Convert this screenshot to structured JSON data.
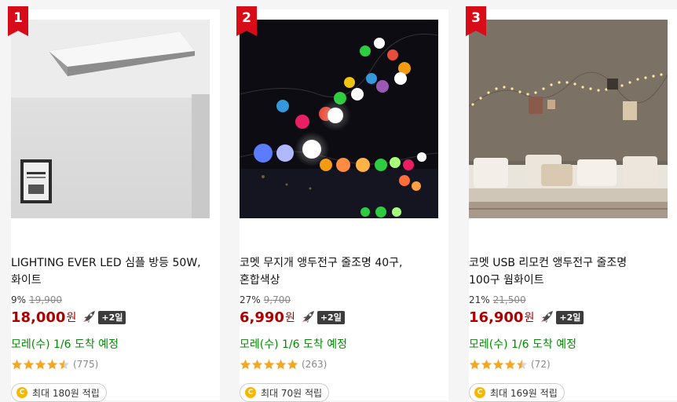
{
  "products": [
    {
      "rank": "1",
      "title_line1": "LIGHTING EVER LED 심플 방등 50W,",
      "title_line2": "화이트",
      "discount": "9%",
      "original_price": "19,900",
      "price": "18,000",
      "currency": "원",
      "delivery_badge": "+2일",
      "delivery_text": "모레(수) 1/6 도착 예정",
      "rating": 4.5,
      "rating_count": "(775)",
      "points": "최대 180원 적립"
    },
    {
      "rank": "2",
      "title_line1": "코멧 무지개 앵두전구 줄조명 40구,",
      "title_line2": "혼합색상",
      "discount": "27%",
      "original_price": "9,700",
      "price": "6,990",
      "currency": "원",
      "delivery_badge": "+2일",
      "delivery_text": "모레(수) 1/6 도착 예정",
      "rating": 5,
      "rating_count": "(263)",
      "points": "최대 70원 적립"
    },
    {
      "rank": "3",
      "title_line1": "코멧 USB 리모컨 앵두전구 줄조명",
      "title_line2": "100구 웜화이트",
      "discount": "21%",
      "original_price": "21,500",
      "price": "16,900",
      "currency": "원",
      "delivery_badge": "+2일",
      "delivery_text": "모레(수) 1/6 도착 예정",
      "rating": 4.5,
      "rating_count": "(72)",
      "points": "최대 169원 적립"
    }
  ],
  "coin_letter": "C",
  "colors": {
    "rank_badge": "#d80c18",
    "price": "#ae0000",
    "delivery": "#008c00",
    "star": "#f5a623"
  },
  "icons": {
    "rank": "ribbon-flag-icon",
    "rocket": "rocket-delivery-icon",
    "star": "star-icon",
    "coin": "coin-icon"
  }
}
